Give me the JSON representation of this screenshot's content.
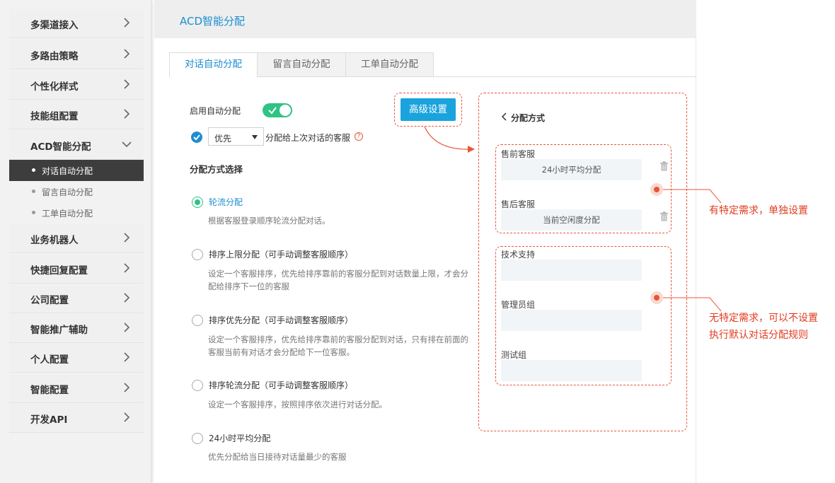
{
  "sidebar": {
    "items": [
      {
        "label": "多渠道接入"
      },
      {
        "label": "多路由策略"
      },
      {
        "label": "个性化样式"
      },
      {
        "label": "技能组配置"
      },
      {
        "label": "ACD智能分配"
      },
      {
        "label": "业务机器人"
      },
      {
        "label": "快捷回复配置"
      },
      {
        "label": "公司配置"
      },
      {
        "label": "智能推广辅助"
      },
      {
        "label": "个人配置"
      },
      {
        "label": "智能配置"
      },
      {
        "label": "开发API"
      }
    ],
    "sub_items": [
      {
        "label": "对话自动分配",
        "active": true
      },
      {
        "label": "留言自动分配",
        "active": false
      },
      {
        "label": "工单自动分配",
        "active": false
      }
    ]
  },
  "header": {
    "title": "ACD智能分配"
  },
  "tabs": [
    {
      "label": "对话自动分配",
      "active": true
    },
    {
      "label": "留言自动分配",
      "active": false
    },
    {
      "label": "工单自动分配",
      "active": false
    }
  ],
  "settings": {
    "enable_label": "启用自动分配",
    "enable_on": true,
    "priority_checked": true,
    "priority_select_value": "优先",
    "priority_text": "分配给上次对话的客服",
    "help_glyph": "?",
    "section_title": "分配方式选择"
  },
  "options": [
    {
      "title": "轮流分配",
      "desc": "根据客服登录顺序轮流分配对话。",
      "selected": true
    },
    {
      "title": "排序上限分配（可手动调整客服顺序）",
      "desc": "设定一个客服排序，优先给排序靠前的客服分配到对话数量上限，才会分配给排序下一位的客服",
      "selected": false
    },
    {
      "title": "排序优先分配（可手动调整客服顺序）",
      "desc": "设定一个客服排序，优先给排序靠前的客服分配到对话，只有排在前面的客服当前有对话才会分配给下一位客服。",
      "selected": false
    },
    {
      "title": "排序轮流分配（可手动调整客服顺序）",
      "desc": "设定一个客服排序，按照排序依次进行对话分配。",
      "selected": false
    },
    {
      "title": "24小时平均分配",
      "desc": "优先分配给当日接待对话量最少的客服",
      "selected": false
    }
  ],
  "advanced_button": "高级设置",
  "panel": {
    "title": "分配方式",
    "groups": [
      {
        "label": "售前客服",
        "value": "24小时平均分配"
      },
      {
        "label": "售后客服",
        "value": "当前空闲度分配"
      },
      {
        "label": "技术支持",
        "value": ""
      },
      {
        "label": "管理员组",
        "value": ""
      },
      {
        "label": "测试组",
        "value": ""
      }
    ]
  },
  "annotations": {
    "specific": "有特定需求，单独设置",
    "default_line1": "无特定需求，可以不设置",
    "default_line2": "执行默认对话分配规则"
  },
  "colors": {
    "accent": "#1d8ed1",
    "green": "#2ec484",
    "annotation": "#e8553a",
    "button": "#1aa3dd"
  }
}
